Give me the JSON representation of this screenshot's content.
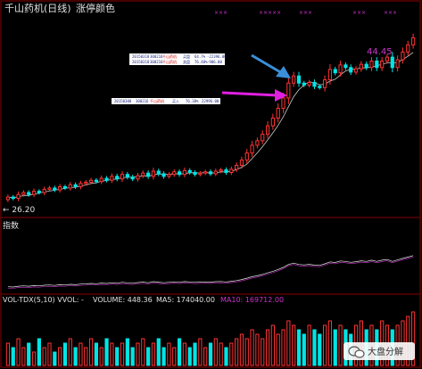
{
  "header": {
    "title": "千山药机(日线)",
    "subtitle": "涨停颜色"
  },
  "main_chart": {
    "top_marks": [
      "×××",
      "×××××",
      "×××",
      "×××",
      "×××"
    ],
    "price_high": "44.45",
    "price_low": "← 26.20"
  },
  "index_panel": {
    "label": "指数"
  },
  "volume_panel": {
    "label": "VOL-TDX(5,10) VVOL: -",
    "volume": "VOLUME: 448.36",
    "ma5": "MA5: 174040.00",
    "ma10": "MA10: 169712.00"
  },
  "annotations": {
    "box1": {
      "row1": [
        "20150318",
        "300216",
        "千山药机",
        "买盘",
        "64.7%",
        "-22396.00"
      ],
      "row2": [
        "20150318",
        "300216",
        "千山药机",
        "卖盘",
        "76.48%",
        "-906.00"
      ]
    },
    "box2": {
      "row1": [
        "20150308",
        "300216",
        "千山药机",
        "买入",
        "76.38%",
        "22996.00"
      ]
    }
  },
  "watermark": {
    "icon": "wechat-icon",
    "text": "大盘分解"
  },
  "colors": {
    "up": "#ff3333",
    "down": "#00e5e5",
    "ma": "#ffffff",
    "purple": "#cc33cc",
    "arrow_blue": "#3a8fd8",
    "arrow_magenta": "#e020e0",
    "grid": "#8b0000"
  },
  "chart_data": {
    "type": "candlestick",
    "start": 26.2,
    "closes": [
      26.6,
      26.4,
      27.0,
      27.3,
      27.0,
      27.5,
      27.3,
      27.8,
      28.0,
      27.7,
      28.2,
      28.0,
      28.5,
      28.2,
      28.7,
      28.9,
      29.2,
      29.0,
      29.5,
      29.2,
      29.8,
      29.4,
      30.1,
      29.7,
      29.4,
      29.9,
      30.3,
      29.8,
      30.6,
      30.2,
      29.8,
      30.1,
      30.5,
      30.1,
      30.7,
      30.4,
      30.1,
      30.3,
      30.5,
      30.2,
      30.6,
      30.8,
      30.4,
      30.9,
      31.5,
      32.3,
      33.4,
      34.6,
      35.3,
      36.3,
      37.6,
      38.8,
      40.3,
      41.9,
      44.2,
      45.3,
      44.2,
      43.9,
      44.3,
      43.7,
      43.5,
      44.7,
      46.3,
      45.8,
      47.0,
      46.6,
      45.9,
      46.4,
      47.1,
      46.6,
      47.6,
      46.6,
      47.6,
      48.2,
      46.6,
      47.8,
      49.0,
      50.1,
      51.2
    ],
    "ylim": [
      24,
      54
    ],
    "labels": {
      "high": 44.45,
      "low": 26.2
    },
    "volume": [
      5,
      4,
      6,
      4,
      5,
      3,
      6,
      4,
      5,
      3,
      4,
      5,
      6,
      4,
      5,
      4,
      6,
      5,
      4,
      6,
      5,
      4,
      5,
      6,
      4,
      5,
      6,
      4,
      5,
      6,
      4,
      5,
      4,
      6,
      5,
      4,
      5,
      6,
      4,
      5,
      6,
      5,
      4,
      5,
      6,
      7,
      6,
      8,
      7,
      6,
      8,
      9,
      7,
      8,
      10,
      9,
      8,
      7,
      9,
      8,
      7,
      9,
      10,
      8,
      9,
      8,
      7,
      9,
      10,
      8,
      9,
      8,
      10,
      9,
      8,
      9,
      10,
      11,
      12
    ]
  }
}
